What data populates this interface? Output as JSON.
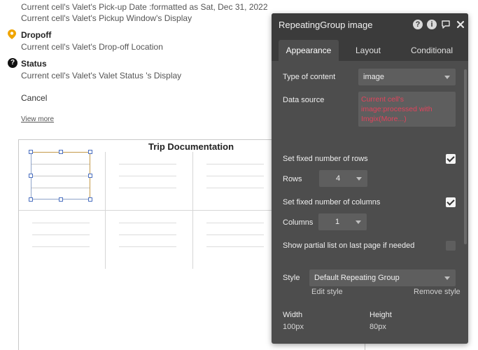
{
  "canvas": {
    "lines": [
      "Current cell's Valet's Pick-up Date :formatted as Sat, Dec 31, 2022",
      "Current cell's Valet's Pickup Window's Display"
    ],
    "dropoff": {
      "heading": "Dropoff",
      "value": "Current cell's Valet's Drop-off Location"
    },
    "status": {
      "heading": "Status",
      "value": "Current cell's Valet's Valet Status 's Display",
      "icon": "?"
    },
    "cancel": "Cancel",
    "view_more": "View more",
    "repeating_group": {
      "title": "Trip Documentation"
    }
  },
  "panel": {
    "title": "RepeatingGroup image",
    "tabs": [
      "Appearance",
      "Layout",
      "Conditional"
    ],
    "active_tab": "Appearance",
    "type_of_content": {
      "label": "Type of content",
      "value": "image"
    },
    "data_source": {
      "label": "Data source",
      "value": "Current cell's image:processed with Imgix(More...)"
    },
    "fixed_rows": {
      "label": "Set fixed number of rows",
      "checked": true
    },
    "rows": {
      "label": "Rows",
      "value": "4"
    },
    "fixed_columns": {
      "label": "Set fixed number of columns",
      "checked": true
    },
    "columns": {
      "label": "Columns",
      "value": "1"
    },
    "partial_list": {
      "label": "Show partial list on last page if needed",
      "checked": false
    },
    "style": {
      "label": "Style",
      "value": "Default Repeating Group",
      "edit": "Edit style",
      "remove": "Remove style"
    },
    "width": {
      "label": "Width",
      "value": "100px"
    },
    "height": {
      "label": "Height",
      "value": "80px"
    },
    "icons": [
      "help-icon",
      "info-icon",
      "comment-icon",
      "close-icon"
    ],
    "colors": {
      "panel_bg": "#4d4d4d",
      "header_bg": "#3b3b3b",
      "data_source_text": "#e0445c",
      "selection_border": "#c49a4a",
      "handle_border": "#4a6fbf"
    }
  }
}
